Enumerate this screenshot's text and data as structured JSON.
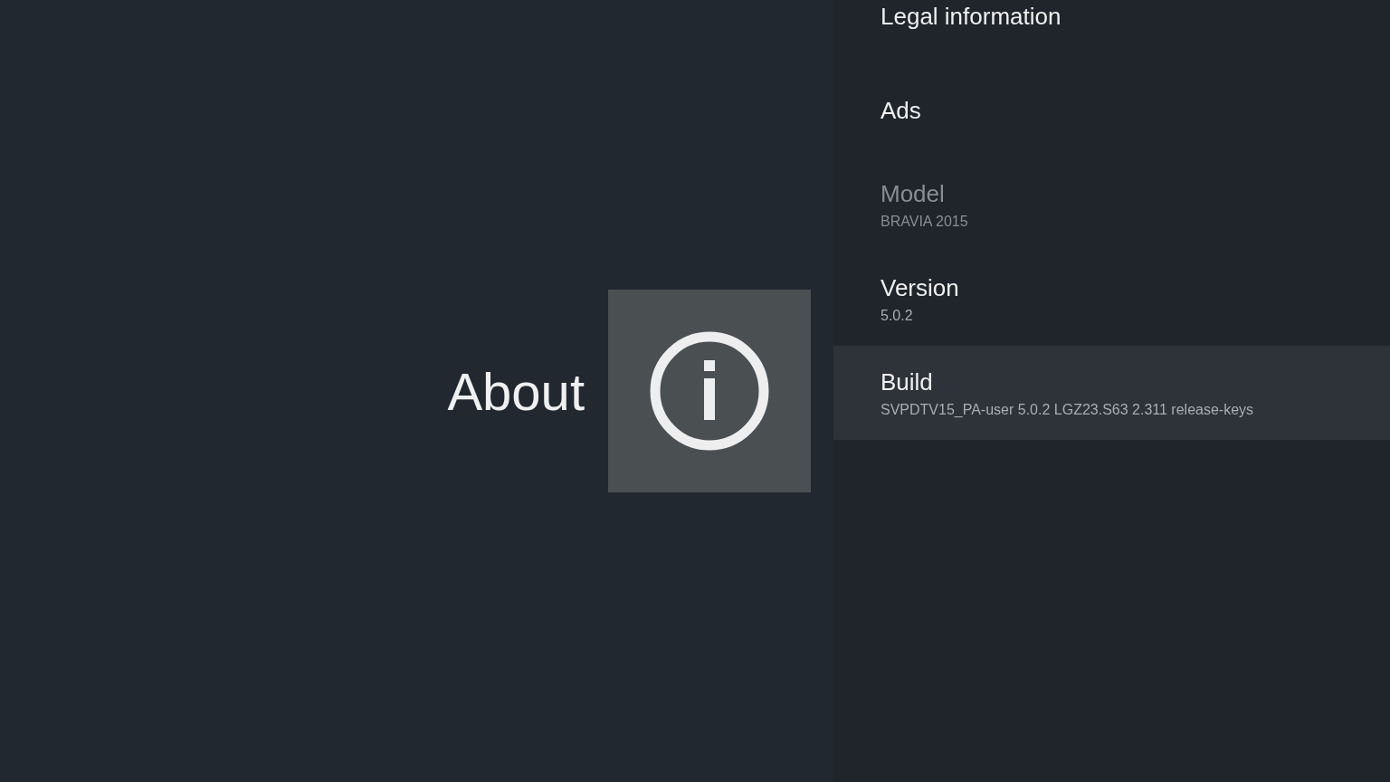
{
  "header": {
    "title": "About"
  },
  "items": [
    {
      "title": "Legal information",
      "disabled": false,
      "selected": false
    },
    {
      "title": "Ads",
      "disabled": false,
      "selected": false
    },
    {
      "title": "Model",
      "subtitle": "BRAVIA 2015",
      "disabled": true,
      "selected": false
    },
    {
      "title": "Version",
      "subtitle": "5.0.2",
      "disabled": false,
      "selected": false
    },
    {
      "title": "Build",
      "subtitle": "SVPDTV15_PA-user 5.0.2 LGZ23.S63 2.311 release-keys",
      "disabled": false,
      "selected": true
    }
  ]
}
